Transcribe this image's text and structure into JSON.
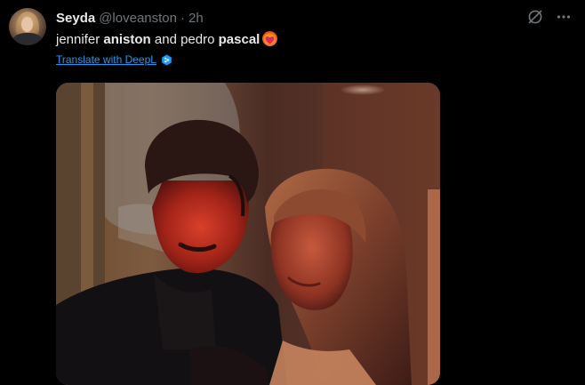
{
  "tweet": {
    "display_name": "Seyda",
    "handle": "@loveanston",
    "separator": "·",
    "time": "2h",
    "text_parts": [
      "jennifer ",
      "aniston",
      " and pedro ",
      "pascal"
    ],
    "emoji": "heart-on-fire-emoji",
    "translate_label": "Translate with DeepL"
  },
  "icons": {
    "grok": "grok-icon",
    "more": "more-options-icon",
    "deepl": "deepl-icon"
  },
  "colors": {
    "background": "#000000",
    "text": "#e7e9ea",
    "muted": "#71767b",
    "link": "#1d9bf0"
  }
}
